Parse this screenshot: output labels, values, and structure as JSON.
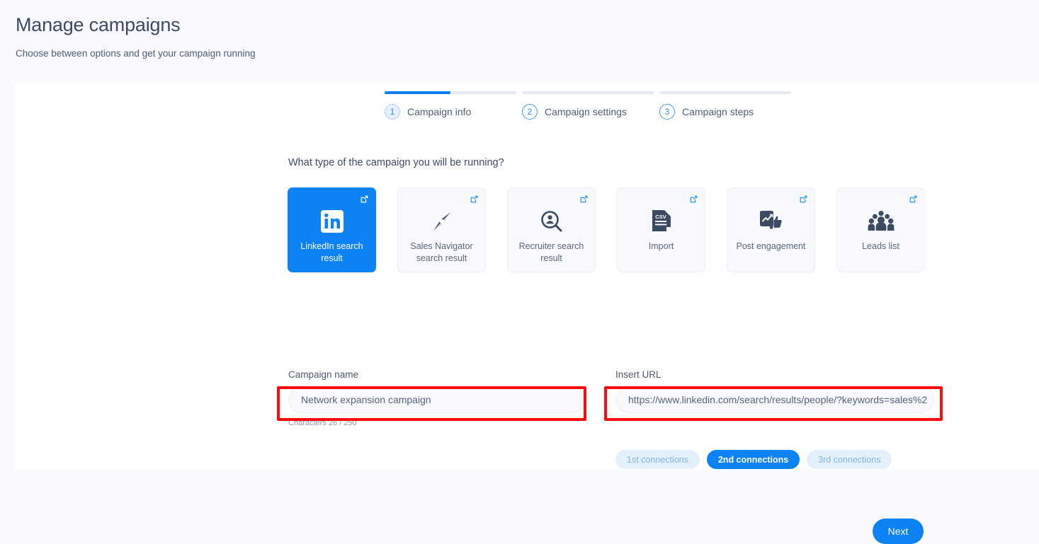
{
  "header": {
    "title": "Manage campaigns",
    "subtitle": "Choose between options and get your campaign running"
  },
  "stepper": {
    "steps": [
      {
        "number": "1",
        "label": "Campaign info",
        "state": "active",
        "progress_pct": 50
      },
      {
        "number": "2",
        "label": "Campaign settings",
        "state": "idle",
        "progress_pct": 0
      },
      {
        "number": "3",
        "label": "Campaign steps",
        "state": "idle",
        "progress_pct": 0
      }
    ]
  },
  "main": {
    "question": "What type of the campaign you will be running?",
    "campaign_types": [
      {
        "label": "LinkedIn search result",
        "icon": "linkedin-icon",
        "selected": true
      },
      {
        "label": "Sales Navigator search result",
        "icon": "compass-icon",
        "selected": false
      },
      {
        "label": "Recruiter search result",
        "icon": "person-search-icon",
        "selected": false
      },
      {
        "label": "Import",
        "icon": "csv-file-icon",
        "selected": false
      },
      {
        "label": "Post engagement",
        "icon": "post-thumbsup-icon",
        "selected": false
      },
      {
        "label": "Leads list",
        "icon": "people-group-icon",
        "selected": false
      }
    ],
    "campaign_name": {
      "label": "Campaign name",
      "value": "Network expansion campaign",
      "placeholder": "Campaign name",
      "char_count": "Characters 26 / 250"
    },
    "insert_url": {
      "label": "Insert URL",
      "value": "https://www.linkedin.com/search/results/people/?keywords=sales%2",
      "placeholder": "Insert URL"
    },
    "connection_filters": [
      {
        "label": "1st connections",
        "selected": false
      },
      {
        "label": "2nd connections",
        "selected": true
      },
      {
        "label": "3rd connections",
        "selected": false
      }
    ],
    "next_label": "Next"
  },
  "colors": {
    "accent": "#0d82f5",
    "page_bg": "#f9f9fe",
    "panel_bg": "#ffffff",
    "text": "#3d4a68",
    "annotation": "#fb0b0b",
    "chip_bg": "#e5f0fd",
    "icon_dark": "#3c4b64"
  }
}
